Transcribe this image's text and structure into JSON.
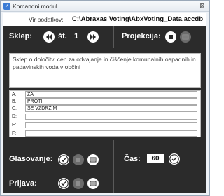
{
  "window": {
    "title": "Komandni modul",
    "close_icon": "close-icon"
  },
  "source": {
    "label": "Vir podatkov:",
    "value": "C:\\Abraxas Voting\\AbxVoting_Data.accdb"
  },
  "session": {
    "label": "Sklep:",
    "number_prefix": "št.",
    "number": "1"
  },
  "projection": {
    "label": "Projekcija:"
  },
  "motion": {
    "text": "Sklep o določitvi cen za odvajanje in čiščenje komunalnih oapadnih in padavinskih voda v občini"
  },
  "answers": [
    {
      "key": "A:",
      "value": "ZA"
    },
    {
      "key": "B:",
      "value": "PROTI"
    },
    {
      "key": "C:",
      "value": "SE VZDRŽIM"
    },
    {
      "key": "D:",
      "value": ""
    },
    {
      "key": "E:",
      "value": ""
    },
    {
      "key": "F:",
      "value": ""
    }
  ],
  "voting": {
    "label": "Glasovanje:"
  },
  "registration": {
    "label": "Prijava:"
  },
  "time": {
    "label": "Čas:",
    "value": "60"
  }
}
